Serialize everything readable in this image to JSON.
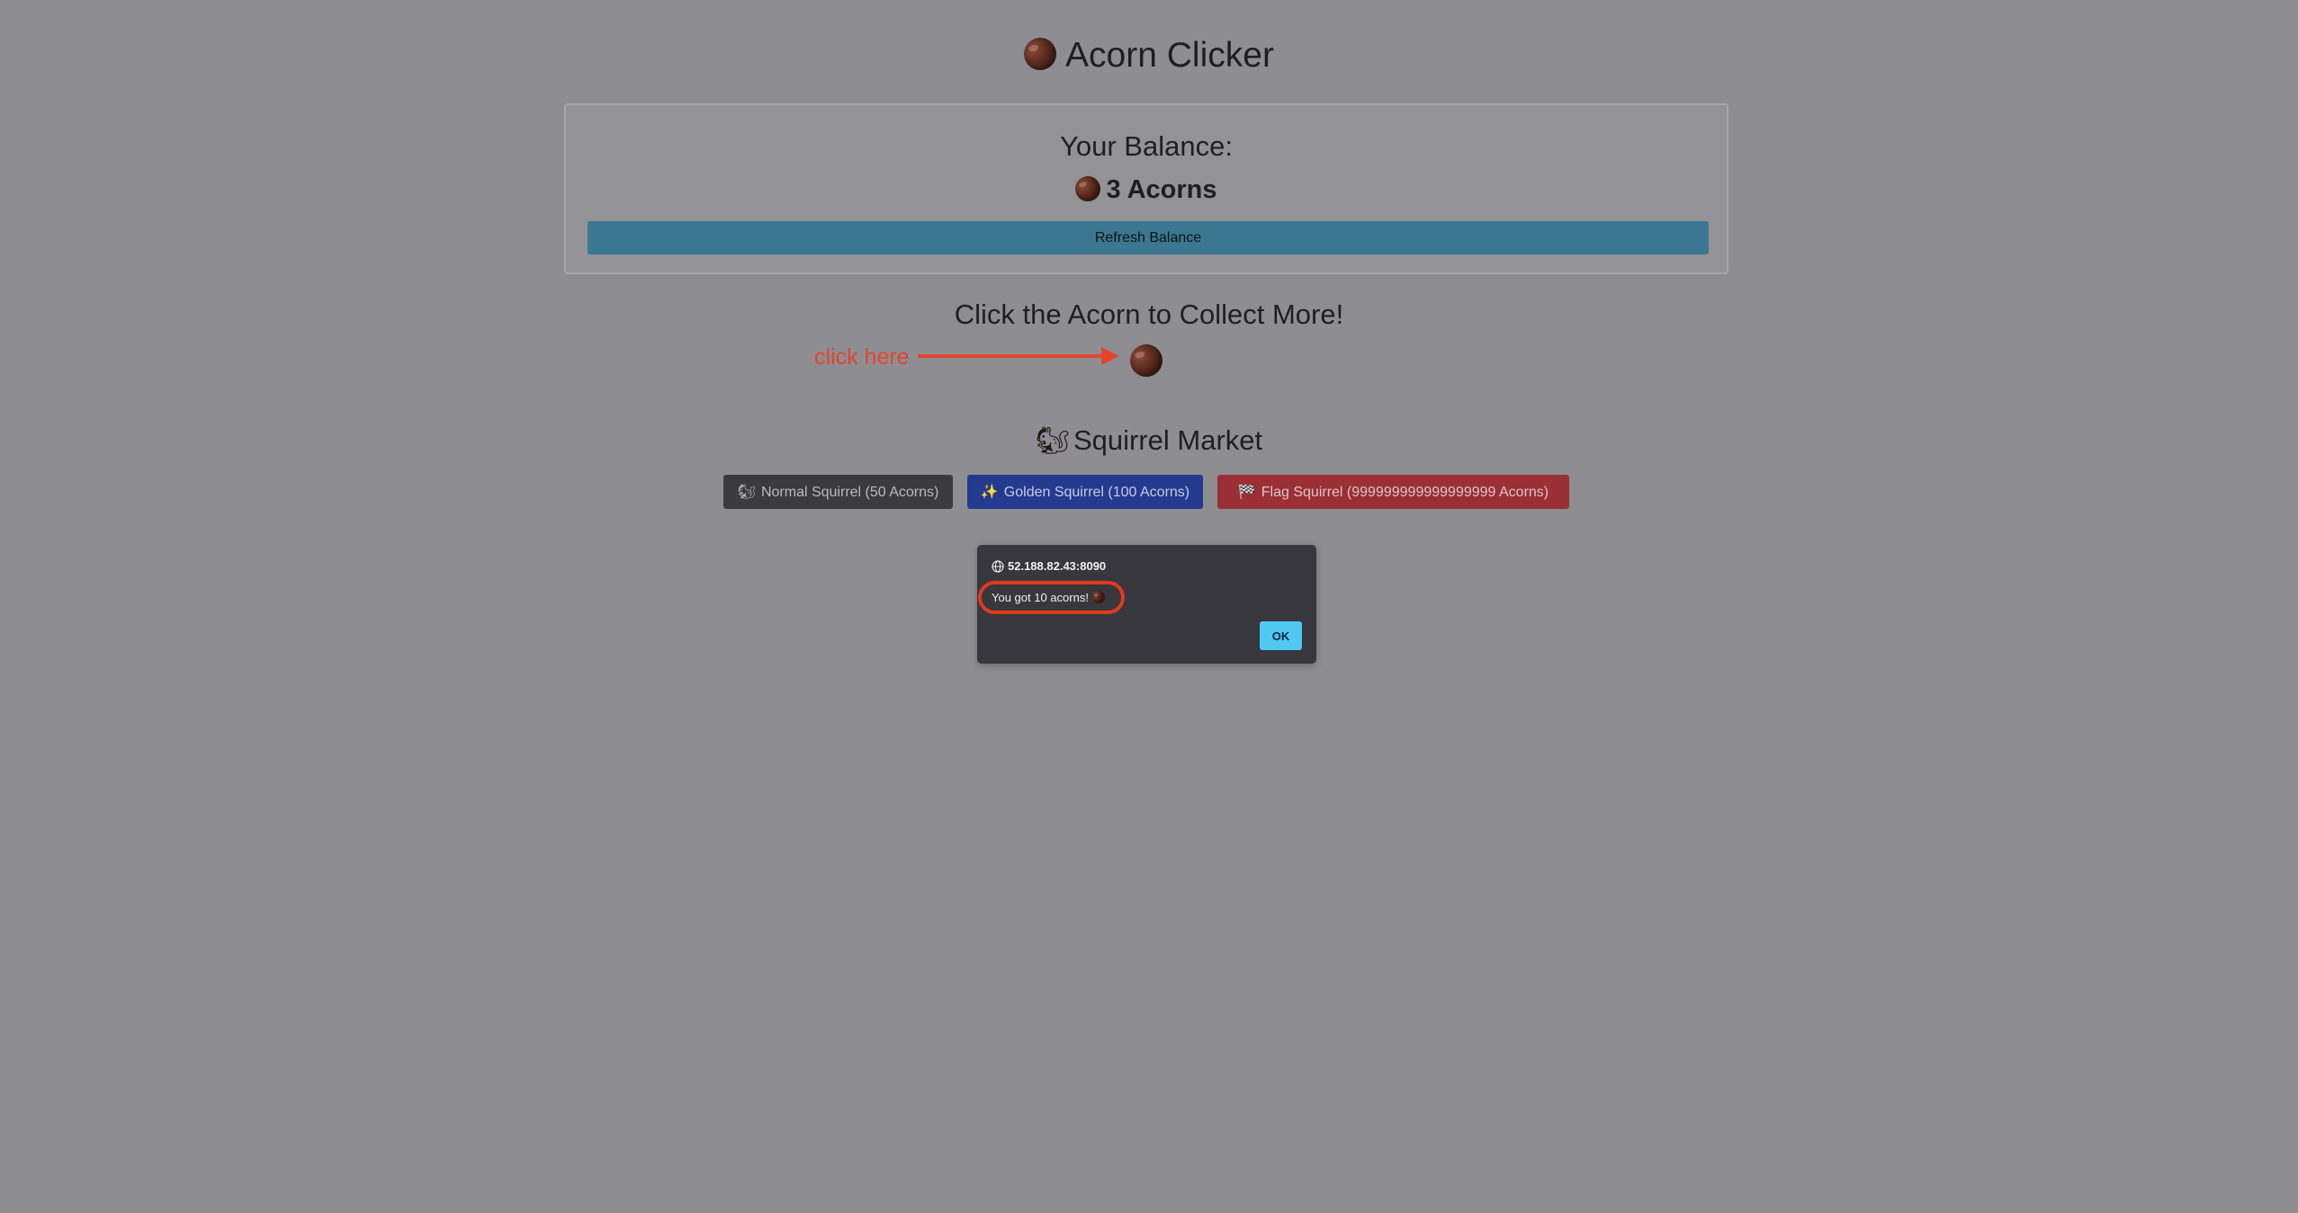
{
  "header": {
    "title": "Acorn Clicker",
    "icon": "acorn-icon"
  },
  "balance": {
    "heading": "Your Balance:",
    "amount": "3 Acorns",
    "refresh_label": "Refresh Balance"
  },
  "collect": {
    "heading": "Click the Acorn to Collect More!",
    "annotation": "click here"
  },
  "market": {
    "heading": "Squirrel Market",
    "buttons": [
      {
        "icon": "squirrel-icon",
        "label": "Normal Squirrel (50 Acorns)"
      },
      {
        "icon": "sparkles-icon",
        "label": "Golden Squirrel (100 Acorns)"
      },
      {
        "icon": "checkered-flag-icon",
        "label": "Flag Squirrel (999999999999999999 Acorns)"
      }
    ]
  },
  "dialog": {
    "origin": "52.188.82.43:8090",
    "message": "You got 10 acorns!",
    "ok_label": "OK"
  },
  "colors": {
    "annotation": "#e2452c",
    "refresh_button": "#3b7791",
    "normal_button": "#3b3b3f",
    "golden_button": "#243a8f",
    "flag_button": "#9a2f36",
    "ok_button": "#4fc8f2"
  }
}
